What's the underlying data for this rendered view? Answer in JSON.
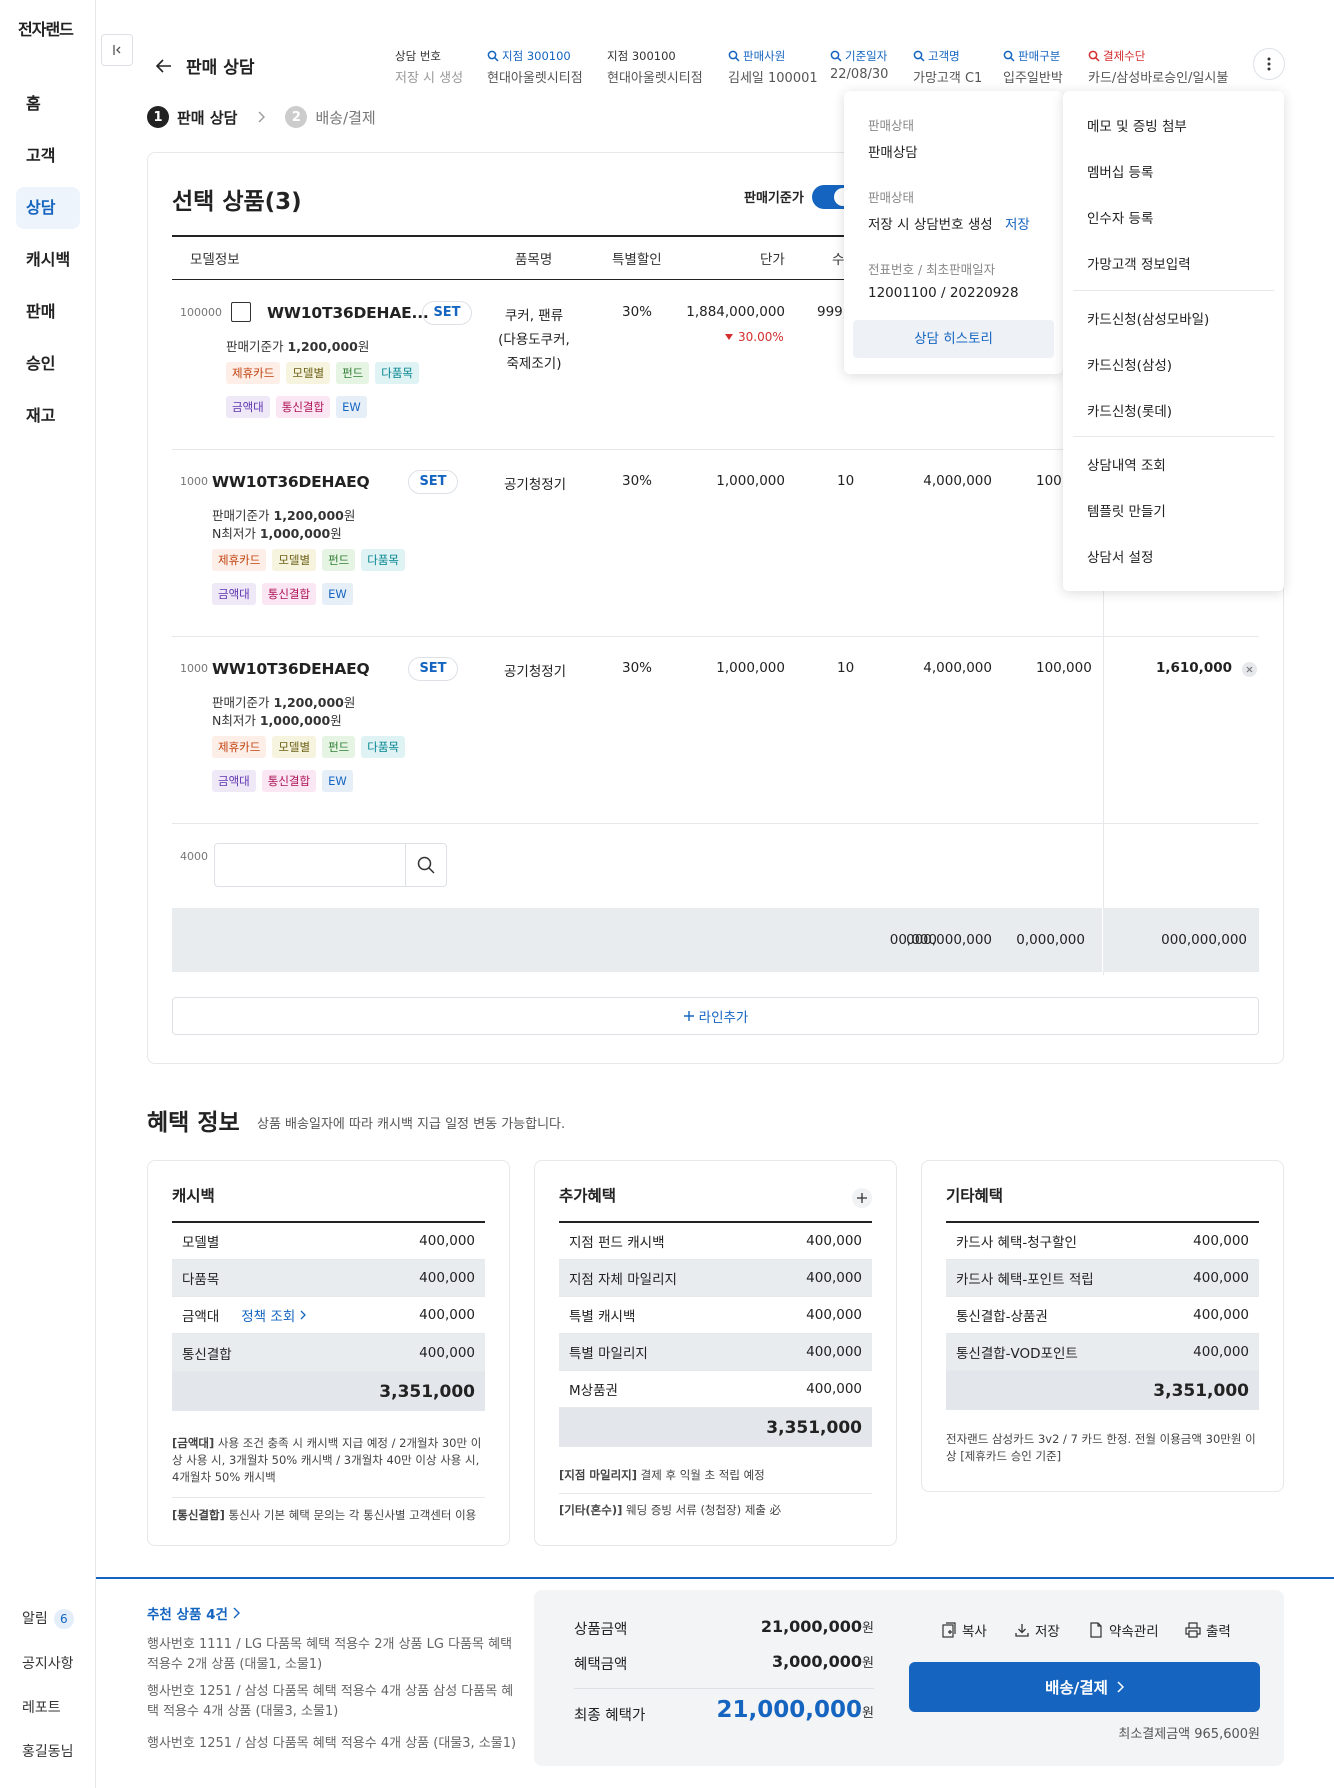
{
  "brand": "전자랜드",
  "nav": [
    "홈",
    "고객",
    "상담",
    "캐시백",
    "판매",
    "승인",
    "재고"
  ],
  "nav_bottom": {
    "alarm": "알림",
    "alarm_count": "6",
    "notice": "공지사항",
    "report": "레포트",
    "user": "홍길동님"
  },
  "header": {
    "title": "판매 상담",
    "fields": [
      {
        "label": "상담 번호",
        "value": "저장 시 생성"
      },
      {
        "label": "지점 300100",
        "value": "현대아울렛시티점"
      },
      {
        "label": "지점 300100",
        "value": "현대아울렛시티점"
      },
      {
        "label": "판매사원",
        "value": "김세일 100001"
      },
      {
        "label": "기준일자",
        "value": "22/08/30"
      },
      {
        "label": "고객명",
        "value": "가망고객 C1"
      },
      {
        "label": "판매구분",
        "value": "입주일반박"
      },
      {
        "label": "결제수단",
        "value": "카드/삼성바로승인/일시불"
      }
    ]
  },
  "steps": {
    "step1_num": "1",
    "step1": "판매 상담",
    "step2_num": "2",
    "step2": "배송/결제"
  },
  "products": {
    "title": "선택 상품(3)",
    "toggle_label": "판매기준가",
    "columns": {
      "model": "모델정보",
      "name": "품목명",
      "discount": "특별할인",
      "price": "단가",
      "qty": "수"
    },
    "rows": [
      {
        "code": "100000",
        "model": "WW10T36DEHAE...",
        "set": "SET",
        "base_label": "판매기준가",
        "base_price": "1,200,000",
        "won": "원",
        "tags": [
          "제휴카드",
          "모델별",
          "펀드",
          "다품목",
          "금액대",
          "통신결합",
          "EW"
        ],
        "item_line1": "쿠커, 팬류",
        "item_line2": "(다용도쿠커,",
        "item_line3": "죽제조기)",
        "discount": "30%",
        "price": "1,884,000,000",
        "price_change": "30.00%",
        "qty": "999,"
      },
      {
        "code": "1000",
        "model": "WW10T36DEHAEQ",
        "set": "SET",
        "base_label": "판매기준가",
        "base_price": "1,200,000",
        "won": "원",
        "min_label": "N최저가",
        "min_price": "1,000,000",
        "tags": [
          "제휴카드",
          "모델별",
          "펀드",
          "다품목",
          "금액대",
          "통신결합",
          "EW"
        ],
        "item": "공기청정기",
        "discount": "30%",
        "price": "1,000,000",
        "qty": "10",
        "amount": "4,000,000",
        "extra": "100,("
      },
      {
        "code": "1000",
        "model": "WW10T36DEHAEQ",
        "set": "SET",
        "base_label": "판매기준가",
        "base_price": "1,200,000",
        "won": "원",
        "min_label": "N최저가",
        "min_price": "1,000,000",
        "tags": [
          "제휴카드",
          "모델별",
          "펀드",
          "다품목",
          "금액대",
          "통신결합",
          "EW"
        ],
        "item": "공기청정기",
        "discount": "30%",
        "price": "1,000,000",
        "qty": "10",
        "amount": "4,000,000",
        "extra": "100,000",
        "final": "1,610,000"
      }
    ],
    "new_row_code": "4000",
    "totals": {
      "qty": "00,000",
      "amount": "000,000,000",
      "extra": "0,000,000",
      "final": "000,000,000"
    },
    "add_line": "라인추가"
  },
  "popover_status": {
    "status_label": "판매상태",
    "status_value": "판매상담",
    "status2_label": "판매상태",
    "status2_value": "저장 시 상담번호 생성",
    "save_link": "저장",
    "slip_label": "전표번호 / 최초판매일자",
    "slip_value": "12001100 / 20220928",
    "history_button": "상담 히스토리"
  },
  "menu": [
    "메모 및 증빙 첨부",
    "멤버십 등록",
    "인수자 등록",
    "가망고객 정보입력",
    "카드신청(삼성모바일)",
    "카드신청(삼성)",
    "카드신청(롯데)",
    "상담내역 조회",
    "템플릿 만들기",
    "상담서 설정"
  ],
  "benefits": {
    "title": "혜택 정보",
    "desc": "상품 배송일자에 따라 캐시백 지급 일정 변동 가능합니다.",
    "cashback": {
      "title": "캐시백",
      "rows": [
        {
          "label": "모델별",
          "value": "400,000"
        },
        {
          "label": "다품목",
          "value": "400,000"
        },
        {
          "label": "금액대",
          "value": "400,000"
        },
        {
          "label": "통신결합",
          "value": "400,000"
        }
      ],
      "policy_link": "정책 조회",
      "total": "3,351,000",
      "note1_bold": "[금액대]",
      "note1": " 사용 조건 충족 시 캐시백 지급 예정 / 2개월차 30만 이상 사용 시, 3개월차 50% 캐시백 / 3개월차 40만 이상 사용 시, 4개월차 50% 캐시백",
      "note2_bold": "[통신결합]",
      "note2": " 통신사 기본 혜택 문의는 각 통신사별 고객센터 이용"
    },
    "extra": {
      "title": "추가혜택",
      "rows": [
        {
          "label": "지점 펀드 캐시백",
          "value": "400,000"
        },
        {
          "label": "지점 자체 마일리지",
          "value": "400,000"
        },
        {
          "label": "특별 캐시백",
          "value": "400,000"
        },
        {
          "label": "특별 마일리지",
          "value": "400,000"
        },
        {
          "label": "M상품권",
          "value": "400,000"
        }
      ],
      "total": "3,351,000",
      "note1_bold": "[지점 마일리지]",
      "note1": " 결제 후 익월 초 적립 예정",
      "note2_bold": "[기타(혼수)]",
      "note2": " 웨딩 증빙 서류 (청첩장) 제출 必"
    },
    "other": {
      "title": "기타혜택",
      "rows": [
        {
          "label": "카드사 혜택-청구할인",
          "value": "400,000"
        },
        {
          "label": "카드사 혜택-포인트 적립",
          "value": "400,000"
        },
        {
          "label": "통신결합-상품권",
          "value": "400,000"
        },
        {
          "label": "통신결합-VOD포인트",
          "value": "400,000"
        }
      ],
      "total": "3,351,000",
      "note": "전자랜드 삼성카드 3v2 / 7 카드 한정. 전월 이용금액 30만원 이상 [제휴카드 승인 기준]"
    }
  },
  "recommend": {
    "title": "추천 상품 4건",
    "items": [
      "행사번호 1111 / LG 다품목 혜택 적용수 2개 상품 LG 다품목 혜택 적용수 2개 상품 (대물1, 소물1)",
      "행사번호 1251 / 삼성 다품목 혜택 적용수 4개 상품 삼성 다품목 혜택 적용수 4개 상품 (대물3, 소물1)",
      "행사번호 1251 / 삼성 다품목 혜택 적용수 4개 상품 (대물3, 소물1)"
    ]
  },
  "summary": {
    "product_label": "상품금액",
    "product_value": "21,000,000",
    "benefit_label": "혜택금액",
    "benefit_value": "3,000,000",
    "final_label": "최종 혜택가",
    "final_value": "21,000,000",
    "won": "원",
    "actions": {
      "copy": "복사",
      "save": "저장",
      "promise": "약속관리",
      "print": "출력"
    },
    "pay_button": "배송/결제",
    "min_pay": "최소결제금액 965,600원"
  },
  "colors": {
    "accent": "#1565c0",
    "danger": "#d32f2f",
    "active_nav_bg": "#eef4fb"
  }
}
